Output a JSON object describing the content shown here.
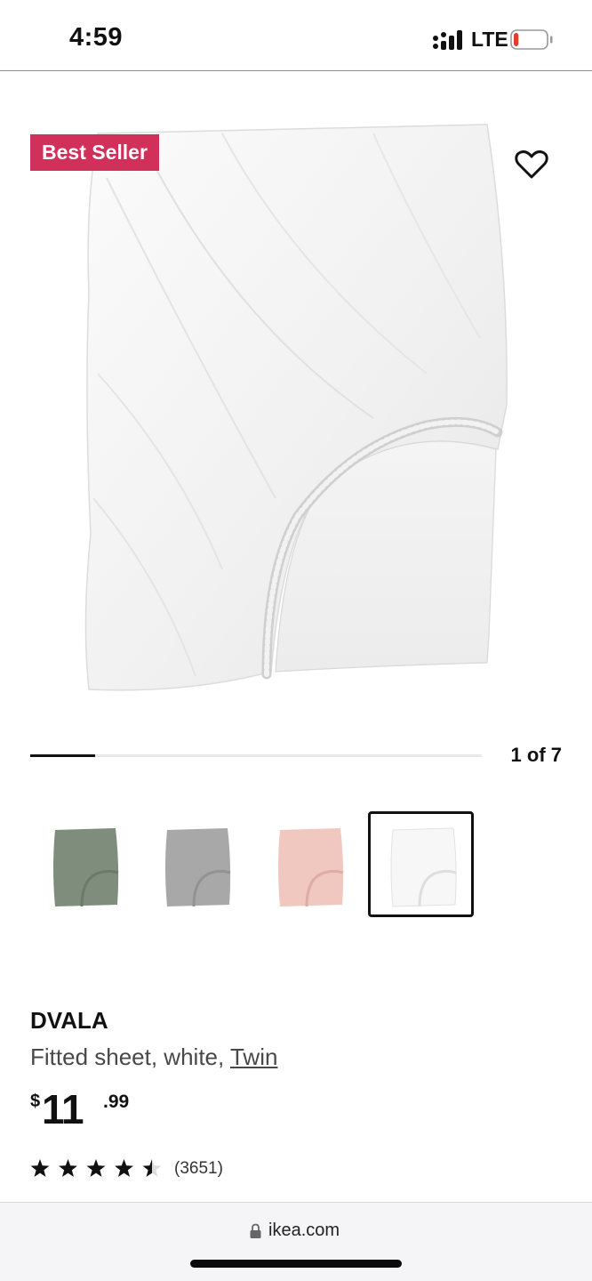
{
  "status_bar": {
    "time": "4:59",
    "network": "LTE",
    "icons": [
      "signal-icon",
      "battery-icon"
    ],
    "battery_level": 0.15,
    "battery_color": "#e23b2f"
  },
  "product": {
    "badge": "Best Seller",
    "badge_color": "#d0305a",
    "favorite_icon": "heart-outline-icon",
    "gallery": {
      "position_label": "1 of 7",
      "current": 1,
      "total": 7
    },
    "swatches": [
      {
        "color_name": "gray-green",
        "color": "#7f8d7d",
        "selected": false
      },
      {
        "color_name": "gray",
        "color": "#a8a8a8",
        "selected": false
      },
      {
        "color_name": "pink",
        "color": "#f0c8c0",
        "selected": false
      },
      {
        "color_name": "white",
        "color": "#f7f7f7",
        "selected": true
      }
    ],
    "name": "DVALA",
    "description_prefix": "Fitted sheet, white, ",
    "size_link": "Twin",
    "price": {
      "currency": "$",
      "integer": "11",
      "decimal": ".99"
    },
    "rating": {
      "stars": 4.5,
      "max": 5,
      "review_count": "(3651)"
    }
  },
  "browser": {
    "lock_icon": "lock-icon",
    "domain": "ikea.com"
  }
}
